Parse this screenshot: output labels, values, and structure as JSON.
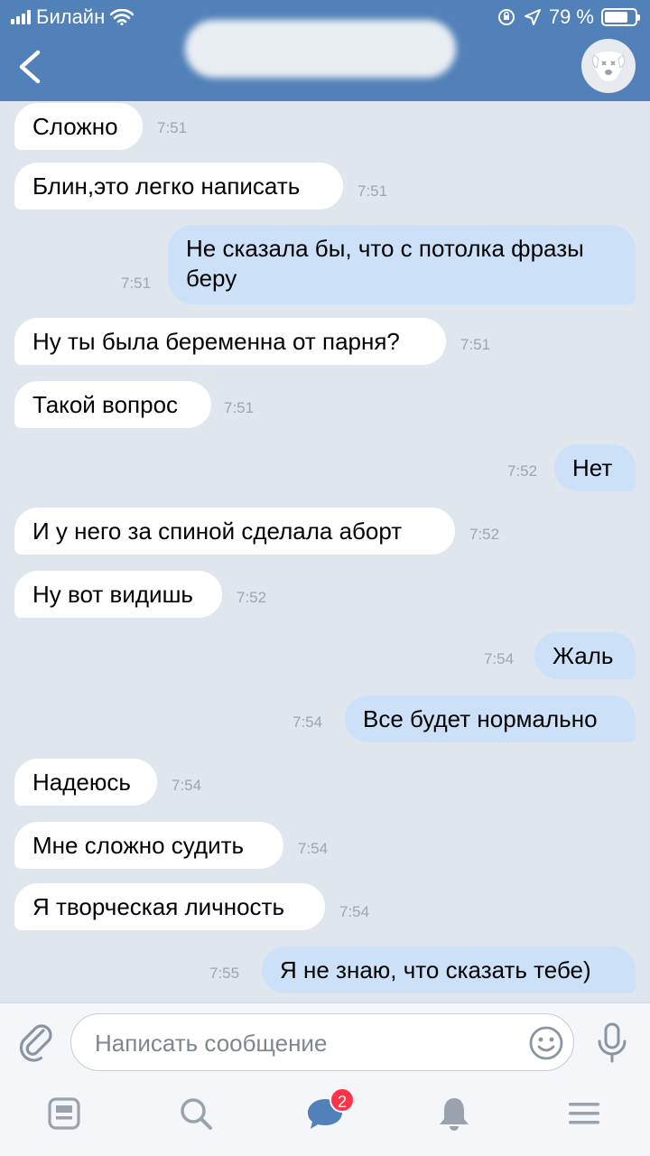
{
  "status": {
    "carrier": "Билайн",
    "battery": "79 %",
    "battery_level": 0.79
  },
  "header": {
    "back_icon": "chevron-left-icon",
    "avatar_icon": "dog-avatar-icon"
  },
  "messages": [
    {
      "dir": "in",
      "text": "Сложно",
      "time": "7:51"
    },
    {
      "dir": "in",
      "text": "Блин,это легко написать",
      "time": "7:51"
    },
    {
      "dir": "out",
      "text": "Не сказала бы, что с потолка фразы беру",
      "time": "7:51"
    },
    {
      "dir": "in",
      "text": "Ну ты была беременна от парня?",
      "time": "7:51"
    },
    {
      "dir": "in",
      "text": "Такой вопрос",
      "time": "7:51"
    },
    {
      "dir": "out",
      "text": "Нет",
      "time": "7:52"
    },
    {
      "dir": "in",
      "text": "И у него за спиной сделала аборт",
      "time": "7:52"
    },
    {
      "dir": "in",
      "text": "Ну вот видишь",
      "time": "7:52"
    },
    {
      "dir": "out",
      "text": "Жаль",
      "time": "7:54"
    },
    {
      "dir": "out",
      "text": "Все будет нормально",
      "time": "7:54"
    },
    {
      "dir": "in",
      "text": "Надеюсь",
      "time": "7:54"
    },
    {
      "dir": "in",
      "text": "Мне сложно судить",
      "time": "7:54"
    },
    {
      "dir": "in",
      "text": "Я творческая личность",
      "time": "7:54"
    },
    {
      "dir": "out",
      "text": "Я не знаю, что сказать тебе)",
      "time": "7:55"
    }
  ],
  "composer": {
    "placeholder": "Написать сообщение",
    "value": ""
  },
  "tabbar": {
    "messages_badge": "2"
  },
  "colors": {
    "header": "#5181b8",
    "incoming_bubble": "#ffffff",
    "outgoing_bubble": "#cce1f8",
    "background": "#dfe6ee",
    "badge": "#ff3347"
  }
}
